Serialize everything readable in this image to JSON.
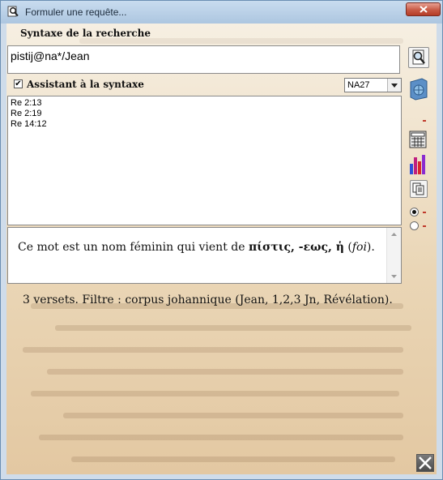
{
  "window": {
    "title": "Formuler une requête..."
  },
  "search": {
    "section_label": "Syntaxe de la recherche",
    "query_value": "pistij@na*/Jean"
  },
  "assistant": {
    "checked": true,
    "check_glyph": "✔",
    "label": "Assistant à la syntaxe",
    "version_selected": "NA27"
  },
  "results": {
    "items": [
      "Re 2:13",
      "Re 2:19",
      "Re 14:12"
    ]
  },
  "info": {
    "prefix": "Ce mot est un nom féminin qui vient de ",
    "greek": "πίστις, -εως, ἡ",
    "gloss_open": " (",
    "gloss": "foi",
    "gloss_close": ")."
  },
  "status": {
    "text": "3 versets. Filtre : corpus johannique (Jean, 1,2,3 Jn, Révélation)."
  },
  "toolbar": {
    "icons": [
      "search-icon",
      "book-globe-icon",
      "red-dash-icon",
      "calculator-icon",
      "bar-chart-icon",
      "copy-icon",
      "radio-on",
      "radio-off",
      "close-icon"
    ]
  },
  "colors": {
    "title_bar": "#b9cfe6",
    "close_button": "#c85a45",
    "background": "#ead6b6"
  }
}
